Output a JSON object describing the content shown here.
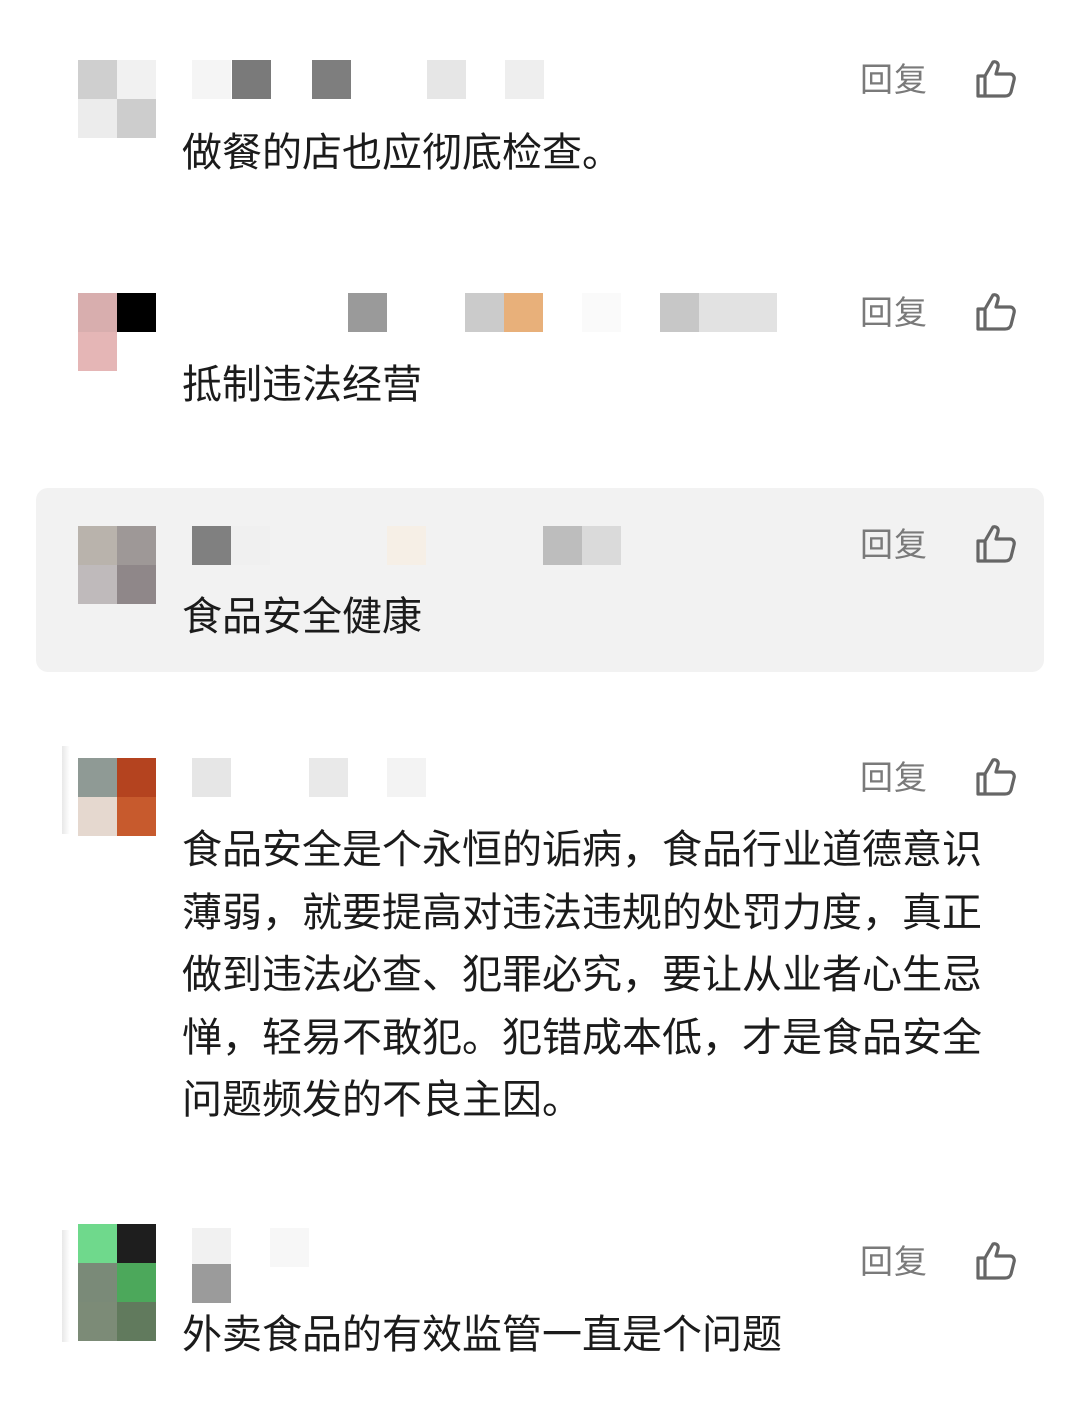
{
  "reply_label": "回复",
  "like_icon": "thumbs-up-icon",
  "comments": [
    {
      "text": "做餐的店也应彻底检查。",
      "highlighted": false,
      "avatar_colors": [
        "#cfcfcf",
        "#f1f1f1",
        "#ececec",
        "#cdcdcd"
      ],
      "name_colors": [
        "#f5f5f5",
        "#7a7a7a",
        "#7e7e7e",
        "#e6e6e6",
        "#eeeeee"
      ]
    },
    {
      "text": "抵制违法经营",
      "highlighted": false,
      "avatar_colors": [
        "#d8aeae",
        "#000000",
        "#e5b6b6",
        "#ffffff"
      ],
      "name_colors": [
        "#9a9a9a",
        "#cbcbcb",
        "#e8b07a",
        "#fafafa",
        "#c7c7c7",
        "#e2e2e2"
      ]
    },
    {
      "text": "食品安全健康",
      "highlighted": true,
      "avatar_colors": [
        "#b9b3ac",
        "#9e9897",
        "#bfbabb",
        "#8f8789"
      ],
      "name_colors": [
        "#808080",
        "#f0f0f0",
        "#f6efe6",
        "#bdbdbd",
        "#dadada"
      ]
    },
    {
      "text": "食品安全是个永恒的诟病，食品行业道德意识薄弱，就要提高对违法违规的处罚力度，真正做到违法必查、犯罪必究，要让从业者心生忌惮，轻易不敢犯。犯错成本低，才是食品安全问题频发的不良主因。",
      "highlighted": false,
      "avatar_colors": [
        "#8f9a95",
        "#b4431f",
        "#e5d8cf",
        "#c75a2d"
      ],
      "name_colors": [
        "#e6e6e6",
        "#e9e9e9",
        "#f3f3f3"
      ]
    },
    {
      "text": "外卖食品的有效监管一直是个问题",
      "highlighted": false,
      "avatar_colors": [
        "#6fd98c",
        "#1e1e1e",
        "#7a8a78",
        "#4ca85b",
        "#7c8b77",
        "#617a5d"
      ],
      "name_colors": [
        "#f1f1f1",
        "#f7f7f7",
        "#9b9b9b"
      ]
    }
  ]
}
